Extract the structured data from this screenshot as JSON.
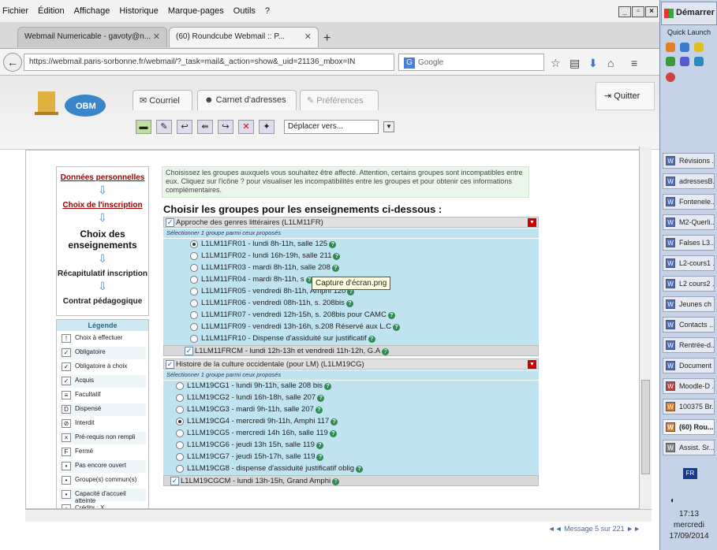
{
  "menu": [
    "Fichier",
    "Édition",
    "Affichage",
    "Historique",
    "Marque-pages",
    "Outils",
    "?"
  ],
  "window_buttons": [
    "_",
    "▫",
    "×"
  ],
  "tabs": [
    {
      "label": "Webmail Numericable - gavoty@n..."
    },
    {
      "label": "(60) Roundcube Webmail :: P..."
    }
  ],
  "url": "https://webmail.paris-sorbonne.fr/webmail/?_task=mail&_action=show&_uid=21136_mbox=IN",
  "search_placeholder": "Google",
  "app": {
    "logo_text": "OBM",
    "tabs": [
      "Courriel",
      "Carnet d'adresses",
      "Préférences"
    ],
    "quit": "Quitter",
    "move_to": "Déplacer vers..."
  },
  "steps": [
    "Données personnelles",
    "Choix de l'inscription",
    "Choix des enseignements",
    "Récapitulatif inscription",
    "Contrat pédagogique"
  ],
  "legend": {
    "title": "Légende",
    "items": [
      {
        "icon": "!",
        "label": "Choix à effectuer"
      },
      {
        "icon": "✓",
        "label": "Obligatoire"
      },
      {
        "icon": "✓",
        "label": "Obligatoire à choix"
      },
      {
        "icon": "✓",
        "label": "Acquis"
      },
      {
        "icon": "≡",
        "label": "Facultatif"
      },
      {
        "icon": "D",
        "label": "Dispensé"
      },
      {
        "icon": "⊘",
        "label": "Interdit"
      },
      {
        "icon": "×",
        "label": "Pré-requis non rempli"
      },
      {
        "icon": "F",
        "label": "Fermé"
      },
      {
        "icon": "•",
        "label": "Pas encore ouvert"
      },
      {
        "icon": "•",
        "label": "Groupe(s) commun(s)"
      },
      {
        "icon": "•",
        "label": "Capacité d'accueil atteinte"
      },
      {
        "icon": "•",
        "label": "Crédits : X"
      }
    ]
  },
  "intro": "Choisissez les groupes auxquels vous souhaitez être affecté. Attention, certains groupes sont incompatibles entre eux. Cliquez sur l'icône ? pour visualiser les incompatibilités entre les groupes et pour obtenir ces informations complémentaires.",
  "heading": "Choisir les groupes pour les enseignements ci-dessous :",
  "group1": {
    "title": "Approche des genres littéraires (L1LM11FR)",
    "select_note": "Sélectionner 1 groupe parmi ceux proposés",
    "options": [
      {
        "label": "L1LM11FR01 - lundi 8h-11h, salle 125",
        "checked": true
      },
      {
        "label": "L1LM11FR02 - lundi 16h-19h, salle 211",
        "checked": false
      },
      {
        "label": "L1LM11FR03 - mardi 8h-11h, salle 208",
        "checked": false
      },
      {
        "label": "L1LM11FR04 - mardi 8h-11h, s",
        "checked": false
      },
      {
        "label": "L1LM11FR05 - vendredi 8h-11h, Amphi 120",
        "checked": false
      },
      {
        "label": "L1LM11FR06 - vendredi 08h-11h, s. 208bis",
        "checked": false
      },
      {
        "label": "L1LM11FR07 - vendredi 12h-15h, s. 208bis pour CAMC",
        "checked": false
      },
      {
        "label": "L1LM11FR09 - vendredi 13h-16h, s.208 Réservé aux L.C",
        "checked": false
      },
      {
        "label": "L1LM11FR10 - Dispense d'assiduité sur justificatif",
        "checked": false
      }
    ],
    "cm": "L1LM11FRCM - lundi 12h-13h et vendredi 11h-12h, G.A"
  },
  "group2": {
    "title": "Histoire de la culture occidentale (pour LM) (L1LM19CG)",
    "select_note": "Sélectionner 1 groupe parmi ceux proposés",
    "options": [
      {
        "label": "L1LM19CG1 - lundi 9h-11h, salle 208 bis",
        "checked": false
      },
      {
        "label": "L1LM19CG2 - lundi 16h-18h, salle 207",
        "checked": false
      },
      {
        "label": "L1LM19CG3 - mardi 9h-11h, salle 207",
        "checked": false
      },
      {
        "label": "L1LM19CG4 - mercredi 9h-11h, Amphi 117",
        "checked": true
      },
      {
        "label": "L1LM19CG5 - mercredi 14h 16h, salle 119",
        "checked": false
      },
      {
        "label": "L1LM19CG6 - jeudi 13h 15h, salle 119",
        "checked": false
      },
      {
        "label": "L1LM19CG7 - jeudi 15h-17h, salle 119",
        "checked": false
      },
      {
        "label": "L1LM19CG8 - dispense d'assiduité justificatif oblig",
        "checked": false
      }
    ],
    "cm": "L1LM19CGCM - lundi 13h-15h, Grand Amphi"
  },
  "tooltip": "Capture d'écran.png",
  "message_nav": "Message 5 sur 221",
  "taskbar": {
    "start": "Démarrer",
    "quicklaunch": "Quick Launch",
    "items": [
      "Révisions ...",
      "adressesB...",
      "Fontenele...",
      "M2-Querli...",
      "Falses L3...",
      "L2-cours1 ...",
      "L2 cours2 ...",
      "Jeunes ch ...",
      "Contacts ...",
      "Rentrée-d...",
      "Document ...",
      "Moodle-D ...",
      "100375 Br...",
      "(60) Rou...",
      "Assist. Sr..."
    ],
    "lang": "FR",
    "clock_time": "17:13",
    "clock_day": "mercredi",
    "clock_date": "17/09/2014"
  }
}
